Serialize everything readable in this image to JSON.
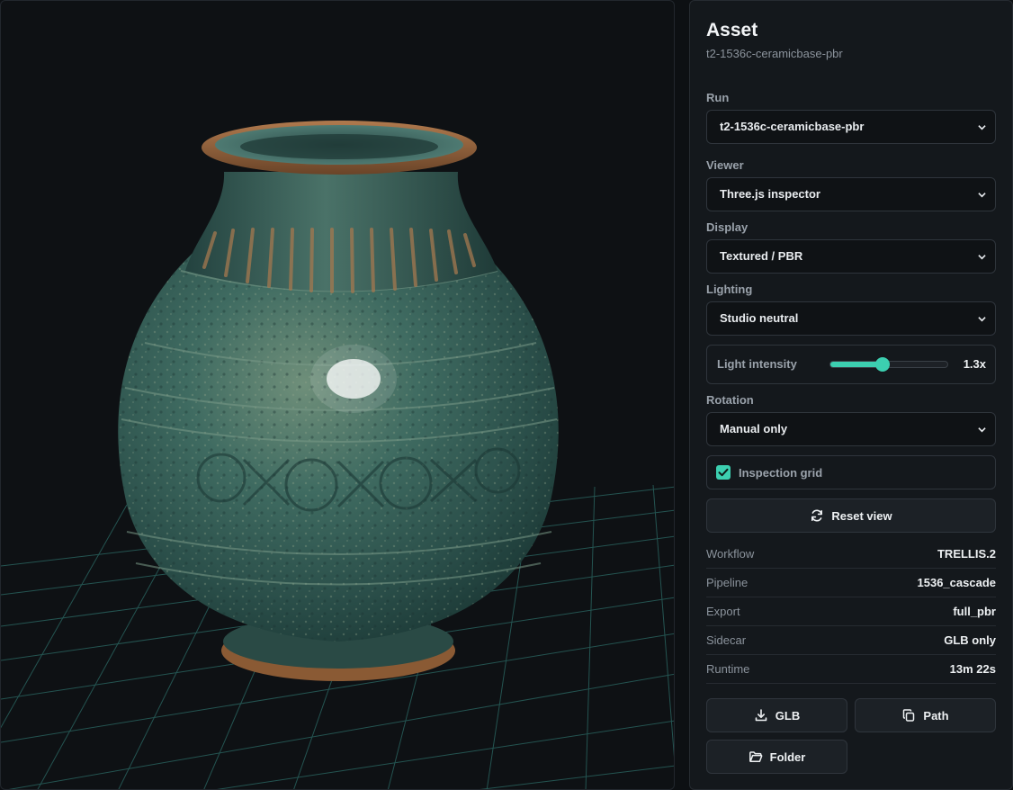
{
  "panel": {
    "title": "Asset",
    "subtitle": "t2-1536c-ceramicbase-pbr"
  },
  "fields": {
    "run": {
      "label": "Run",
      "value": "t2-1536c-ceramicbase-pbr"
    },
    "viewer": {
      "label": "Viewer",
      "value": "Three.js inspector"
    },
    "display": {
      "label": "Display",
      "value": "Textured / PBR"
    },
    "lighting": {
      "label": "Lighting",
      "value": "Studio neutral"
    },
    "rotation": {
      "label": "Rotation",
      "value": "Manual only"
    }
  },
  "light_intensity": {
    "label": "Light intensity",
    "value_text": "1.3x",
    "fraction": 0.45
  },
  "inspection_grid": {
    "label": "Inspection grid",
    "checked": true
  },
  "reset_button": {
    "label": "Reset view",
    "icon": "refresh-icon"
  },
  "meta": [
    {
      "key": "Workflow",
      "value": "TRELLIS.2"
    },
    {
      "key": "Pipeline",
      "value": "1536_cascade"
    },
    {
      "key": "Export",
      "value": "full_pbr"
    },
    {
      "key": "Sidecar",
      "value": "GLB only"
    },
    {
      "key": "Runtime",
      "value": "13m 22s"
    }
  ],
  "actions": {
    "glb": {
      "label": "GLB",
      "icon": "download-icon"
    },
    "path": {
      "label": "Path",
      "icon": "copy-icon"
    },
    "folder": {
      "label": "Folder",
      "icon": "folder-icon"
    }
  },
  "colors": {
    "accent": "#3ccfb0",
    "panel_bg": "#14181c",
    "viewport_bg": "#0e1114",
    "grid": "#2c6b66"
  }
}
